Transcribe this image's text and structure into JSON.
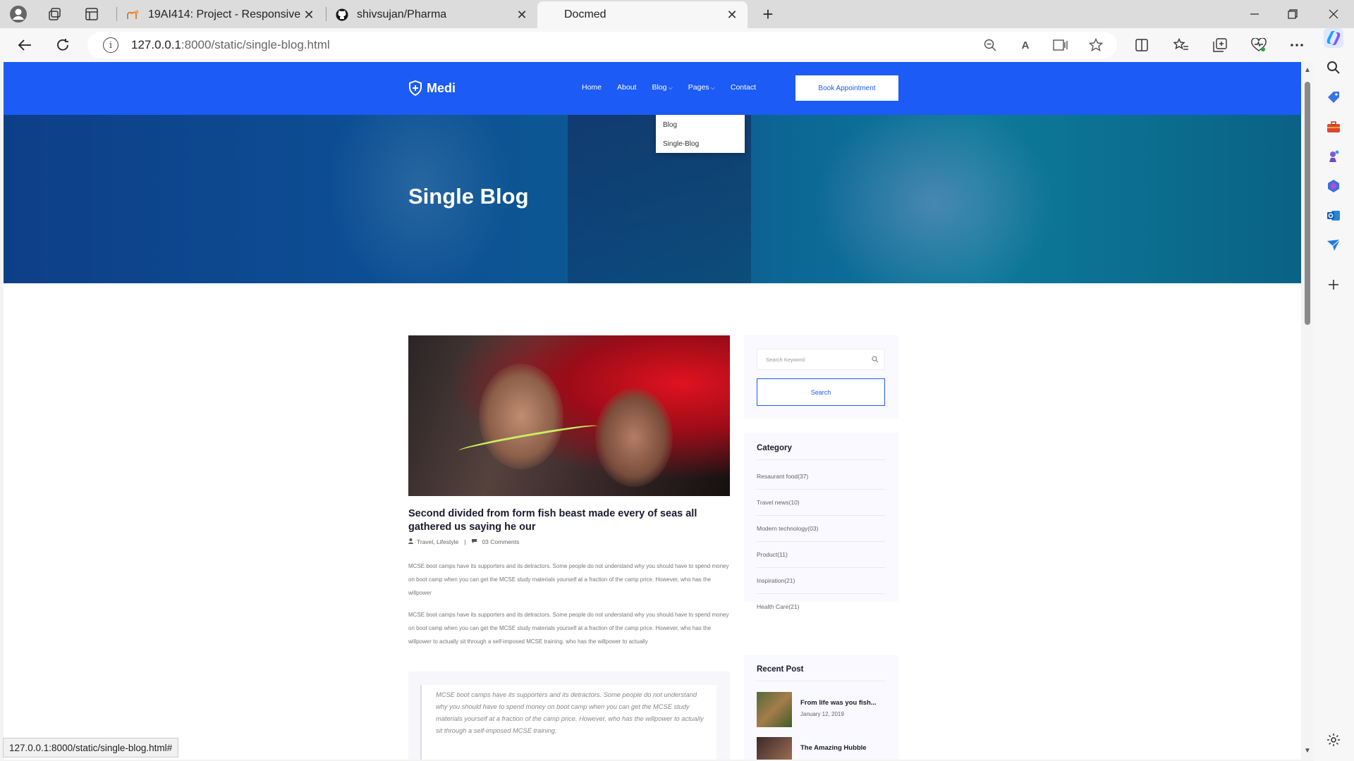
{
  "browser": {
    "tabs": [
      {
        "title": "19AI414: Project - Responsive Web",
        "icon": "moodle-icon",
        "active": false
      },
      {
        "title": "shivsujan/Pharma",
        "icon": "github-icon",
        "active": false
      },
      {
        "title": "Docmed",
        "icon": "",
        "active": true
      }
    ],
    "url_host": "127.0.0.1",
    "url_rest": ":8000/static/single-blog.html",
    "status_url": "127.0.0.1:8000/static/single-blog.html#"
  },
  "site": {
    "brand": "Medi",
    "nav": [
      "Home",
      "About",
      "Blog",
      "Pages",
      "Contact"
    ],
    "book_button": "Book Appointment",
    "dropdown": [
      "Blog",
      "Single-Blog"
    ],
    "accent": "#1c5bf5"
  },
  "hero": {
    "title": "Single Blog"
  },
  "post": {
    "title": "Second divided from form fish beast made every of seas all gathered us saying he our",
    "tags": "Travel, Lifestyle",
    "separator": "|",
    "comments": "03 Comments",
    "paragraph1": "MCSE boot camps have its supporters and its detractors. Some people do not understand why you should have to spend money on boot camp when you can get the MCSE study materials yourself at a fraction of the camp price. However, who has the willpower",
    "paragraph2": "MCSE boot camps have its supporters and its detractors. Some people do not understand why you should have to spend money on boot camp when you can get the MCSE study materials yourself at a fraction of the camp price. However, who has the willpower to actually sit through a self-imposed MCSE training. who has the willpower to actually",
    "quote": "MCSE boot camps have its supporters and its detractors. Some people do not understand why you should have to spend money on boot camp when you can get the MCSE study materials yourself at a fraction of the camp price. However, who has the willpower to actually sit through a self-imposed MCSE training."
  },
  "sidebar": {
    "search_placeholder": "Search Keyword",
    "search_button": "Search",
    "category_title": "Category",
    "categories": [
      "Resaurant food(37)",
      "Travel news(10)",
      "Modern technology(03)",
      "Product(11)",
      "Inspiration(21)",
      "Health Care(21)"
    ],
    "recent_title": "Recent Post",
    "recent_posts": [
      {
        "title": "From life was you fish...",
        "date": "January 12, 2019"
      },
      {
        "title": "The Amazing Hubble",
        "date": ""
      }
    ]
  }
}
